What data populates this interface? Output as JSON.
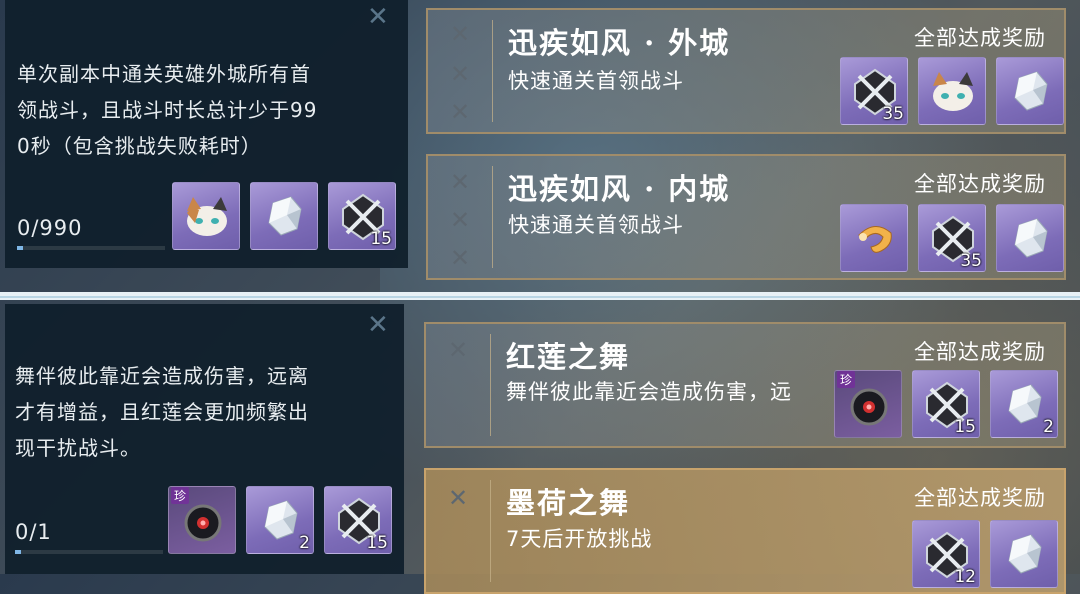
{
  "top_detail": {
    "description": "单次副本中通关英雄外城所有首领战斗，且战斗时长总计少于990秒（包含挑战失败耗时）",
    "line1": "单次副本中通关英雄外城所有首",
    "line2": "领战斗，且战斗时长总计少于99",
    "line3": "0秒（包含挑战失败耗时）",
    "progress": "0/990",
    "progress_fraction": 0.02,
    "rewards": [
      {
        "icon": "cat-mask-icon",
        "count": ""
      },
      {
        "icon": "crystal-icon",
        "count": ""
      },
      {
        "icon": "crossed-swords-badge-icon",
        "count": "15"
      }
    ]
  },
  "bottom_detail": {
    "line1": "舞伴彼此靠近会造成伤害，远离",
    "line2": "才有增益，且红莲会更加频繁出",
    "line3": "现干扰战斗。",
    "progress": "0/1",
    "progress_fraction": 0.02,
    "rewards": [
      {
        "icon": "dark-orb-icon",
        "count": "",
        "tag": "珍"
      },
      {
        "icon": "crystal-icon",
        "count": "2"
      },
      {
        "icon": "crossed-swords-badge-icon",
        "count": "15"
      }
    ]
  },
  "cards": [
    {
      "title": "迅疾如风 · 外城",
      "subtitle": "快速通关首领战斗",
      "all_reward": "全部达成奖励",
      "rewards": [
        {
          "icon": "crossed-swords-badge-icon",
          "count": "35"
        },
        {
          "icon": "cat-mask-icon",
          "count": ""
        },
        {
          "icon": "crystal-icon",
          "count": ""
        }
      ]
    },
    {
      "title": "迅疾如风 · 内城",
      "subtitle": "快速通关首领战斗",
      "all_reward": "全部达成奖励",
      "rewards": [
        {
          "icon": "fox-scarf-icon",
          "count": ""
        },
        {
          "icon": "crossed-swords-badge-icon",
          "count": "35"
        },
        {
          "icon": "crystal-icon",
          "count": ""
        }
      ]
    },
    {
      "title": "红莲之舞",
      "subtitle": "舞伴彼此靠近会造成伤害，远",
      "all_reward": "全部达成奖励",
      "rewards": [
        {
          "icon": "dark-orb-icon",
          "count": "",
          "tag": "珍"
        },
        {
          "icon": "crossed-swords-badge-icon",
          "count": "15"
        },
        {
          "icon": "crystal-icon",
          "count": "2"
        }
      ]
    },
    {
      "title": "墨荷之舞",
      "subtitle": "7天后开放挑战",
      "all_reward": "全部达成奖励",
      "rewards": [
        {
          "icon": "crossed-swords-badge-icon",
          "count": "12"
        },
        {
          "icon": "crystal-icon",
          "count": ""
        }
      ]
    }
  ],
  "colors": {
    "panel": "#10202c",
    "card_gold": "#c8a36c",
    "reward_purple": "#8a7ac4",
    "progress": "#7fb7e6"
  }
}
